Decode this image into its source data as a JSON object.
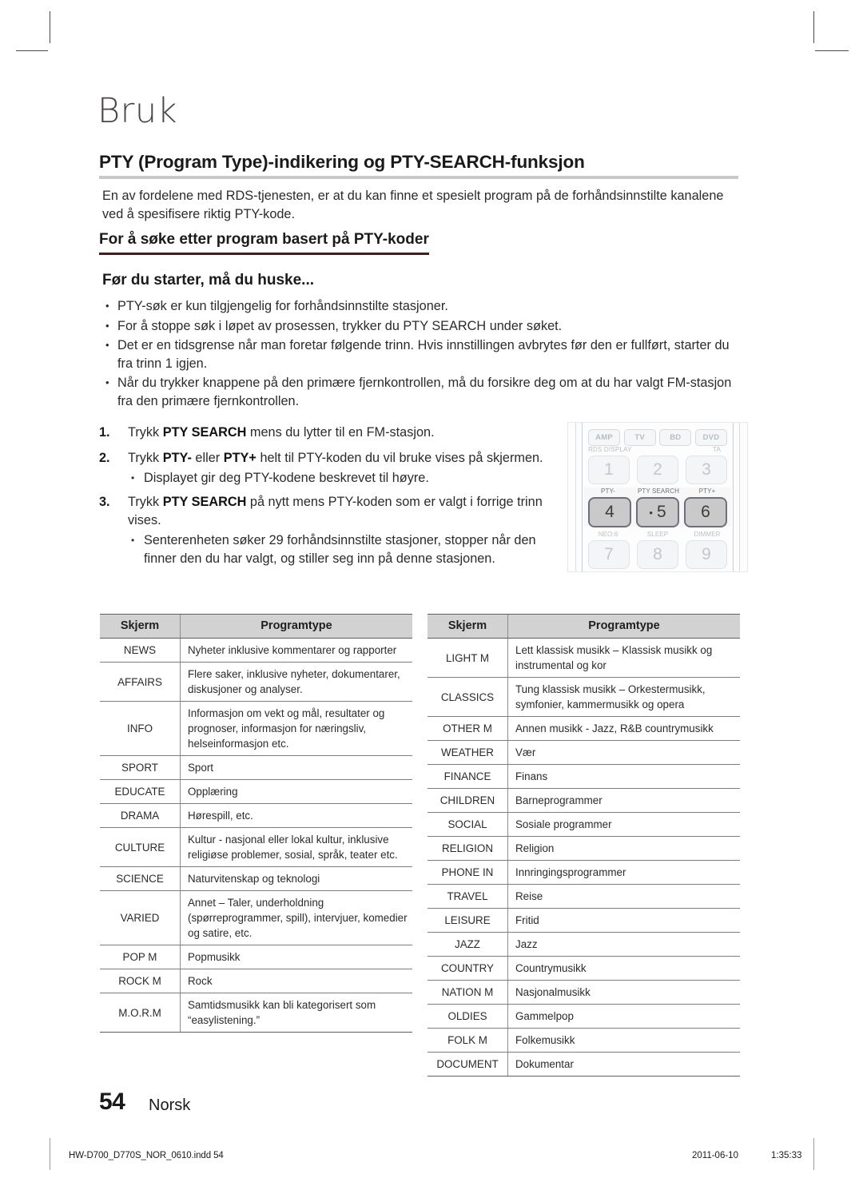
{
  "chapter": {
    "title": "Bruk"
  },
  "heading": {
    "main": "PTY (Program Type)-indikering og PTY-SEARCH-funksjon"
  },
  "intro": {
    "text": "En av fordelene med RDS-tjenesten, er at du kan finne et spesielt program på de forhåndsinnstilte kanalene ved å spesifisere riktig PTY-kode."
  },
  "subheadings": {
    "search": "For å søke etter program basert på PTY-koder",
    "before": "Før du starter, må du huske..."
  },
  "bullets": [
    "PTY-søk er kun tilgjengelig for forhåndsinnstilte stasjoner.",
    "For å stoppe søk i løpet av prosessen, trykker du PTY SEARCH under søket.",
    "Det er en tidsgrense når man foretar følgende trinn. Hvis innstillingen avbrytes før den er fullført, starter du fra trinn 1 igjen.",
    "Når du trykker knappene på den primære fjernkontrollen, må du forsikre deg om at du har valgt FM-stasjon fra den primære fjernkontrollen."
  ],
  "steps": [
    {
      "num": "1.",
      "pre": "Trykk ",
      "bold": "PTY SEARCH",
      "post": " mens du lytter til en FM-stasjon.",
      "sub": []
    },
    {
      "num": "2.",
      "pre": "Trykk ",
      "bold": "PTY-",
      "mid": " eller ",
      "bold2": "PTY+",
      "post": " helt til PTY-koden du vil bruke vises på skjermen.",
      "sub": [
        "Displayet gir deg PTY-kodene beskrevet til høyre."
      ]
    },
    {
      "num": "3.",
      "pre": "Trykk ",
      "bold": "PTY SEARCH",
      "post": " på nytt mens PTY-koden som er valgt i forrige trinn vises.",
      "sub": [
        "Senterenheten søker 29 forhåndsinnstilte stasjoner, stopper når den finner den du har valgt, og stiller seg inn på denne stasjonen."
      ]
    }
  ],
  "remote": {
    "source_buttons": [
      "AMP",
      "TV",
      "BD",
      "DVD"
    ],
    "source_sub_labels": {
      "amp": "RDS DISPLAY",
      "dvd": "TA"
    },
    "rows": [
      {
        "labels": [
          "",
          "",
          ""
        ],
        "keys": [
          "1",
          "2",
          "3"
        ],
        "active": false
      },
      {
        "labels": [
          "PTY-",
          "PTY SEARCH",
          "PTY+"
        ],
        "keys": [
          "4",
          "5",
          "6"
        ],
        "active": true
      },
      {
        "labels": [
          "NEO:6",
          "SLEEP",
          "DIMMER"
        ],
        "keys": [
          "7",
          "8",
          "9"
        ],
        "active": false
      }
    ]
  },
  "table_headers": {
    "code": "Skjerm",
    "type": "Programtype"
  },
  "table_left": [
    {
      "code": "NEWS",
      "desc": "Nyheter inklusive kommentarer og rapporter"
    },
    {
      "code": "AFFAIRS",
      "desc": "Flere saker, inklusive nyheter, dokumentarer, diskusjoner og analyser."
    },
    {
      "code": "INFO",
      "desc": "Informasjon om vekt og mål, resultater og prognoser, informasjon for næringsliv, helseinformasjon etc."
    },
    {
      "code": "SPORT",
      "desc": "Sport"
    },
    {
      "code": "EDUCATE",
      "desc": "Opplæring"
    },
    {
      "code": "DRAMA",
      "desc": "Hørespill, etc."
    },
    {
      "code": "CULTURE",
      "desc": "Kultur - nasjonal eller lokal kultur, inklusive religiøse problemer, sosial, språk, teater etc."
    },
    {
      "code": "SCIENCE",
      "desc": "Naturvitenskap og teknologi"
    },
    {
      "code": "VARIED",
      "desc": "Annet – Taler, underholdning (spørreprogrammer, spill), intervjuer, komedier og satire, etc."
    },
    {
      "code": "POP M",
      "desc": "Popmusikk"
    },
    {
      "code": "ROCK M",
      "desc": "Rock"
    },
    {
      "code": "M.O.R.M",
      "desc": "Samtidsmusikk kan bli kategorisert som “easylistening.”"
    }
  ],
  "table_right": [
    {
      "code": "LIGHT M",
      "desc": "Lett klassisk musikk – Klassisk musikk og instrumental og kor"
    },
    {
      "code": "CLASSICS",
      "desc": "Tung klassisk musikk – Orkestermusikk, symfonier, kammermusikk og opera"
    },
    {
      "code": "OTHER M",
      "desc": "Annen musikk - Jazz, R&B countrymusikk"
    },
    {
      "code": "WEATHER",
      "desc": "Vær"
    },
    {
      "code": "FINANCE",
      "desc": "Finans"
    },
    {
      "code": "CHILDREN",
      "desc": "Barneprogrammer"
    },
    {
      "code": "SOCIAL",
      "desc": "Sosiale programmer"
    },
    {
      "code": "RELIGION",
      "desc": "Religion"
    },
    {
      "code": "PHONE IN",
      "desc": "Innringingsprogrammer"
    },
    {
      "code": "TRAVEL",
      "desc": "Reise"
    },
    {
      "code": "LEISURE",
      "desc": "Fritid"
    },
    {
      "code": "JAZZ",
      "desc": "Jazz"
    },
    {
      "code": "COUNTRY",
      "desc": "Countrymusikk"
    },
    {
      "code": "NATION M",
      "desc": "Nasjonalmusikk"
    },
    {
      "code": "OLDIES",
      "desc": "Gammelpop"
    },
    {
      "code": "FOLK M",
      "desc": "Folkemusikk"
    },
    {
      "code": "DOCUMENT",
      "desc": "Dokumentar"
    }
  ],
  "footer": {
    "page_number": "54",
    "language": "Norsk",
    "file_name": "HW-D700_D770S_NOR_0610.indd   54",
    "date": "2011-06-10",
    "time": "1:35:33"
  }
}
